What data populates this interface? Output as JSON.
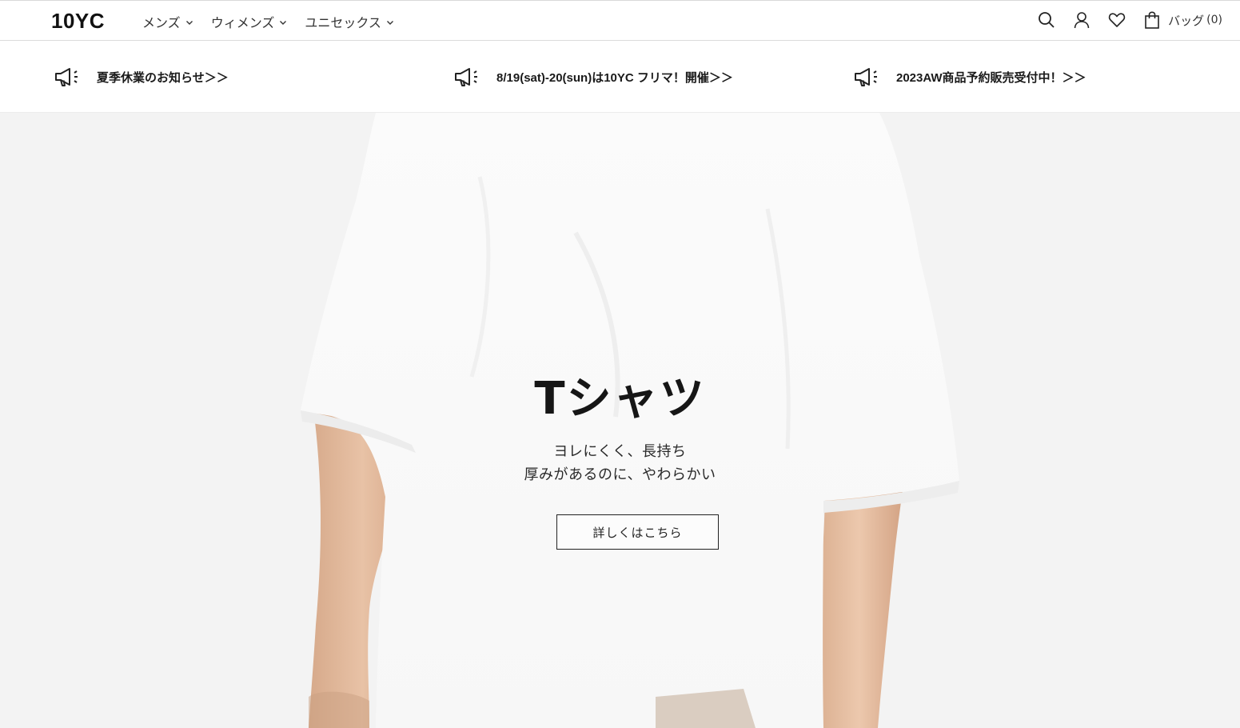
{
  "header": {
    "logo": "10YC",
    "nav": [
      {
        "label": "メンズ"
      },
      {
        "label": "ウィメンズ"
      },
      {
        "label": "ユニセックス"
      }
    ],
    "tools": {
      "search_icon": "search-icon",
      "account_icon": "user-icon",
      "wishlist_icon": "heart-icon",
      "bag_icon": "shopping-bag-icon",
      "bag_label": "バッグ",
      "bag_count": "(0)"
    }
  },
  "announcements": [
    {
      "icon": "megaphone-icon",
      "text": "夏季休業のお知らせ＞＞"
    },
    {
      "icon": "megaphone-icon",
      "text": "8/19(sat)-20(sun)は10YC フリマ！開催＞＞"
    },
    {
      "icon": "megaphone-icon",
      "text": "2023AW商品予約販売受付中！＞＞"
    }
  ],
  "hero": {
    "title": "Tシャツ",
    "subtitle_line1": "ヨレにくく、長持ち",
    "subtitle_line2": "厚みがあるのに、やわらかい",
    "cta_label": "詳しくはこちら"
  },
  "colors": {
    "text": "#1a1a1a",
    "hero_bg": "#f4f4f4",
    "border": "#dcdcdc"
  }
}
